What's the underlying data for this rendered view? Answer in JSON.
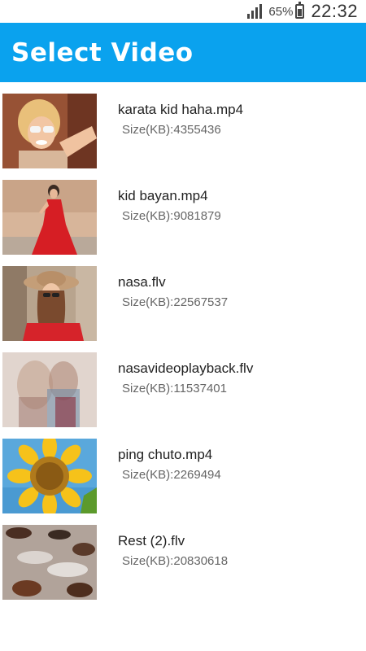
{
  "status_bar": {
    "battery_percent": "65%",
    "time": "22:32",
    "icons": [
      "signal-icon",
      "battery-charging-icon"
    ]
  },
  "app_bar": {
    "title": "Select Video",
    "color": "#0aa2ee"
  },
  "videos": [
    {
      "name": "karata kid haha.mp4",
      "size": "Size(KB):4355436",
      "thumbnail": "woman-sunglasses-thumbnail"
    },
    {
      "name": "kid bayan.mp4",
      "size": "Size(KB):9081879",
      "thumbnail": "woman-red-dress-thumbnail"
    },
    {
      "name": "nasa.flv",
      "size": "Size(KB):22567537",
      "thumbnail": "woman-hat-thumbnail"
    },
    {
      "name": "nasavideoplayback.flv",
      "size": "Size(KB):11537401",
      "thumbnail": "double-exposure-thumbnail"
    },
    {
      "name": "ping chuto.mp4",
      "size": "Size(KB):2269494",
      "thumbnail": "sunflower-thumbnail"
    },
    {
      "name": "Rest (2).flv",
      "size": "Size(KB):20830618",
      "thumbnail": "river-stones-thumbnail"
    }
  ]
}
